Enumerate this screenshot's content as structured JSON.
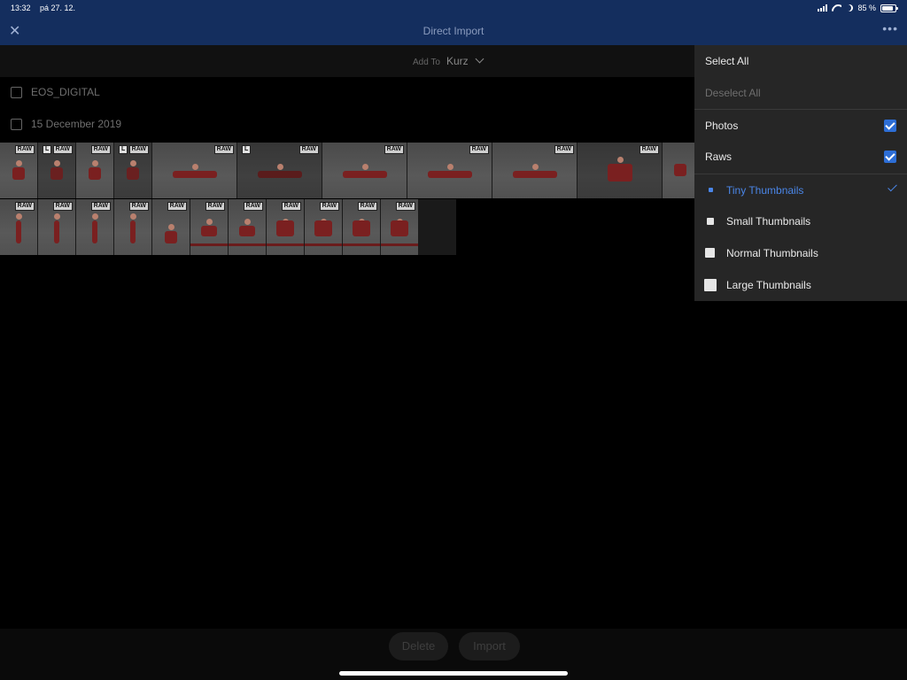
{
  "status": {
    "time": "13:32",
    "date": "pá 27. 12.",
    "battery": "85 %"
  },
  "nav": {
    "title": "Direct Import",
    "close_glyph": "✕",
    "more_glyph": "•••"
  },
  "addto": {
    "label": "Add To",
    "value": "Kurz"
  },
  "groups": {
    "source": "EOS_DIGITAL",
    "date": "15 December 2019"
  },
  "badges": {
    "raw": "RAW",
    "photo": "L"
  },
  "buttons": {
    "delete": "Delete",
    "import": "Import"
  },
  "menu": {
    "select_all": "Select All",
    "deselect_all": "Deselect All",
    "photos": "Photos",
    "raws": "Raws",
    "tiny": "Tiny Thumbnails",
    "small": "Small Thumbnails",
    "normal": "Normal Thumbnails",
    "large": "Large Thumbnails"
  },
  "colors": {
    "nav_bg": "#142e5e",
    "accent": "#4a86e8",
    "checkbox": "#2d6ed6"
  }
}
